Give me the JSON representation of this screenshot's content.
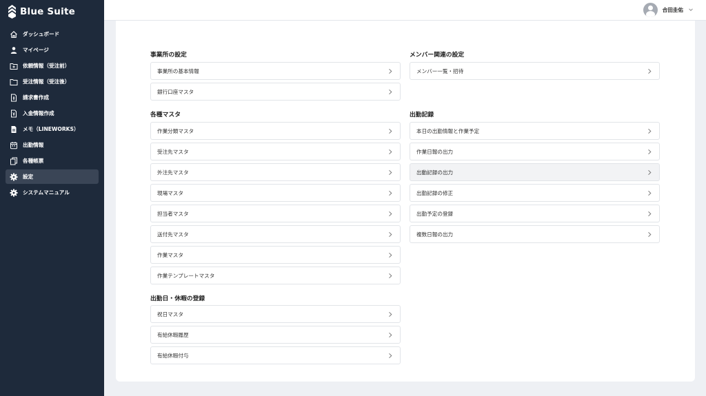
{
  "app": {
    "name": "Blue Suite"
  },
  "sidebar": {
    "items": [
      {
        "label": "ダッシュボード",
        "icon": "home-icon",
        "active": false
      },
      {
        "label": "マイページ",
        "icon": "person-icon",
        "active": false
      },
      {
        "label": "依頼情報（受注前）",
        "icon": "folder-plus-icon",
        "active": false
      },
      {
        "label": "受注情報（受注後）",
        "icon": "folder-icon",
        "active": false
      },
      {
        "label": "請求書作成",
        "icon": "invoice-icon",
        "active": false
      },
      {
        "label": "入金情報作成",
        "icon": "payment-icon",
        "active": false
      },
      {
        "label": "メモ（LINEWORKS）",
        "icon": "document-icon",
        "active": false
      },
      {
        "label": "出勤情報",
        "icon": "calendar-icon",
        "active": false
      },
      {
        "label": "各種帳票",
        "icon": "copy-icon",
        "active": false
      },
      {
        "label": "設定",
        "icon": "gear-icon",
        "active": true
      },
      {
        "label": "システムマニュアル",
        "icon": "gear-icon",
        "active": false
      }
    ]
  },
  "header": {
    "user_name": "合田圭佑"
  },
  "sections": {
    "office": {
      "title": "事業所の設定",
      "items": [
        "事業所の基本情報",
        "銀行口座マスタ"
      ]
    },
    "masters": {
      "title": "各種マスタ",
      "items": [
        "作業分類マスタ",
        "受注先マスタ",
        "外注先マスタ",
        "現場マスタ",
        "担当者マスタ",
        "送付先マスタ",
        "作業マスタ",
        "作業テンプレートマスタ"
      ]
    },
    "holidays": {
      "title": "出勤日・休暇の登録",
      "items": [
        "祝日マスタ",
        "有給休暇履歴",
        "有給休暇付与"
      ]
    },
    "members": {
      "title": "メンバー関連の設定",
      "items": [
        "メンバー一覧・招待"
      ]
    },
    "attendance": {
      "title": "出勤記録",
      "items": [
        "本日の出勤情報と作業予定",
        "作業日報の出力",
        "出動記録の出力",
        "出勤記録の修正",
        "出勤予定の登録",
        "複数日報の出力"
      ]
    }
  },
  "colors": {
    "sidebar_bg": "#1e2a3b",
    "sidebar_active": "#3a4556",
    "page_bg": "#eef0f4",
    "row_border": "#e1e4e8",
    "row_highlight": "#f2f3f5"
  }
}
